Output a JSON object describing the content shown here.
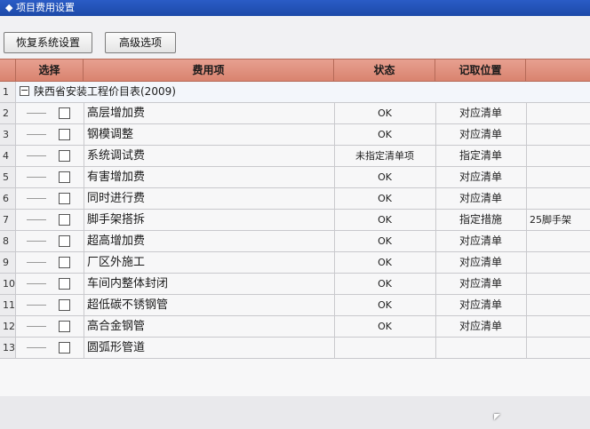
{
  "window": {
    "title": "◆ 项目费用设置"
  },
  "toolbar": {
    "restore_label": "恢复系统设置",
    "advanced_label": "高级选项"
  },
  "table": {
    "headers": {
      "select": "选择",
      "cost": "费用项",
      "status": "状态",
      "location": "记取位置"
    },
    "group": {
      "rownum": "1",
      "toggle": "−",
      "name": "陕西省安装工程价目表(2009)"
    },
    "rows": [
      {
        "rownum": "2",
        "name": "高层增加费",
        "status": "OK",
        "location": "对应清单",
        "note": ""
      },
      {
        "rownum": "3",
        "name": "钢模调整",
        "status": "OK",
        "location": "对应清单",
        "note": ""
      },
      {
        "rownum": "4",
        "name": "系统调试费",
        "status": "未指定清单项",
        "location": "指定清单",
        "note": ""
      },
      {
        "rownum": "5",
        "name": "有害增加费",
        "status": "OK",
        "location": "对应清单",
        "note": ""
      },
      {
        "rownum": "6",
        "name": "同时进行费",
        "status": "OK",
        "location": "对应清单",
        "note": ""
      },
      {
        "rownum": "7",
        "name": "脚手架搭拆",
        "status": "OK",
        "location": "指定措施",
        "note": "25脚手架"
      },
      {
        "rownum": "8",
        "name": "超高增加费",
        "status": "OK",
        "location": "对应清单",
        "note": ""
      },
      {
        "rownum": "9",
        "name": "厂区外施工",
        "status": "OK",
        "location": "对应清单",
        "note": ""
      },
      {
        "rownum": "10",
        "name": "车间内整体封闭",
        "status": "OK",
        "location": "对应清单",
        "note": ""
      },
      {
        "rownum": "11",
        "name": "超低碳不锈钢管",
        "status": "OK",
        "location": "对应清单",
        "note": ""
      },
      {
        "rownum": "12",
        "name": "高合金钢管",
        "status": "OK",
        "location": "对应清单",
        "note": ""
      },
      {
        "rownum": "13",
        "name": "圆弧形管道",
        "status": "",
        "location": "",
        "note": ""
      }
    ]
  },
  "colors": {
    "header_bg": "#d9836f",
    "title_bg": "#1d4aa8"
  },
  "icons": {
    "group_toggle": "minus-box-icon",
    "pointer": "mouse-cursor-icon"
  }
}
